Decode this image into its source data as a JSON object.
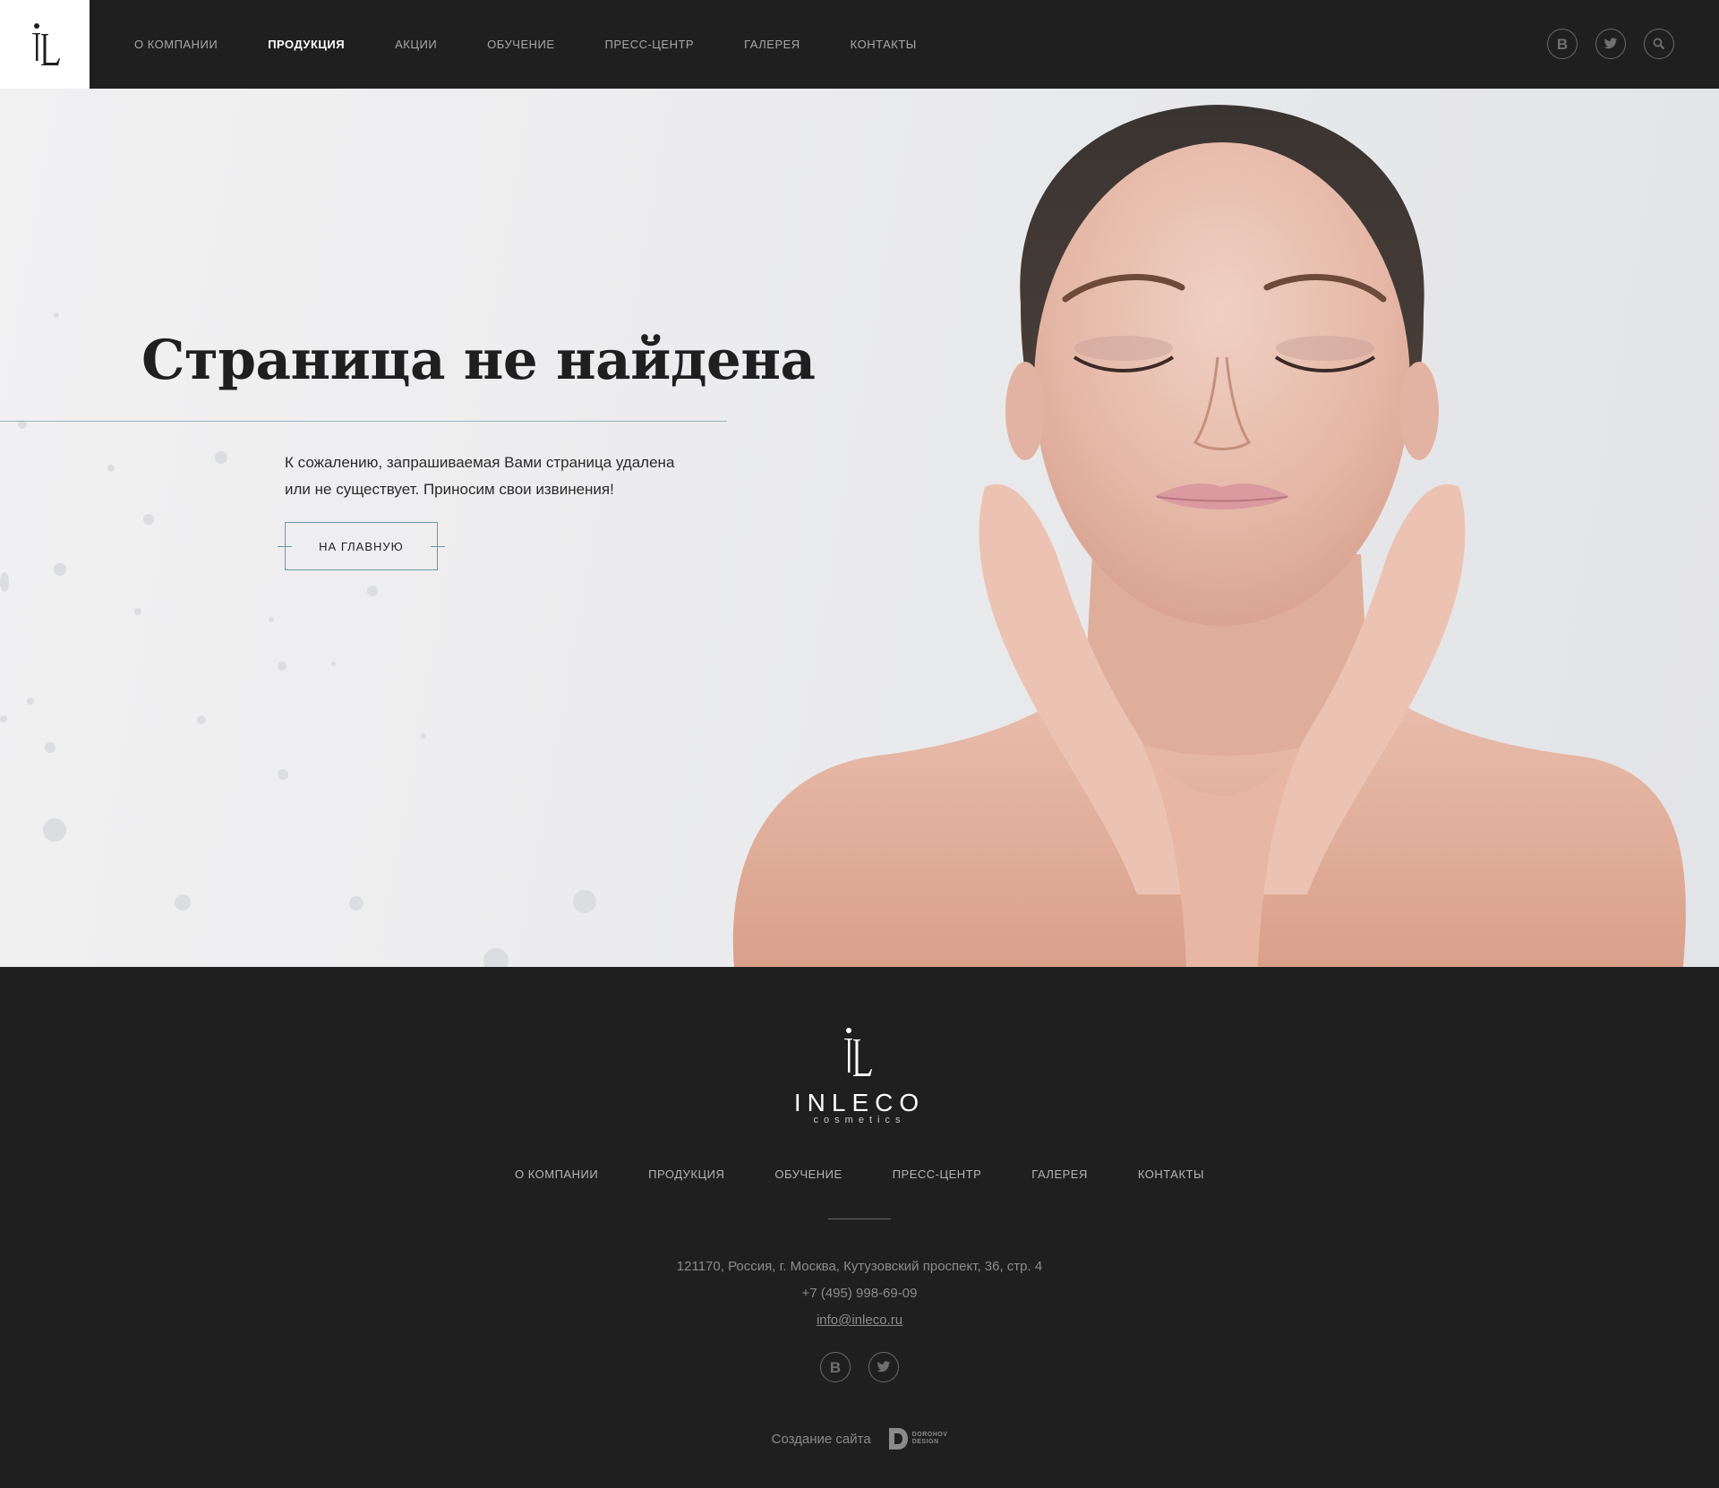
{
  "header": {
    "logo_icon": "inleco-monogram-icon",
    "nav": [
      {
        "label": "О КОМПАНИИ",
        "active": false
      },
      {
        "label": "ПРОДУКЦИЯ",
        "active": true
      },
      {
        "label": "АКЦИИ",
        "active": false
      },
      {
        "label": "ОБУЧЕНИЕ",
        "active": false
      },
      {
        "label": "ПРЕСС-ЦЕНТР",
        "active": false
      },
      {
        "label": "ГАЛЕРЕЯ",
        "active": false
      },
      {
        "label": "КОНТАКТЫ",
        "active": false
      }
    ],
    "vk_letter": "B",
    "icons": [
      "vk-icon",
      "twitter-icon",
      "search-icon"
    ]
  },
  "hero": {
    "title": "Страница не найдена",
    "text_line1": "К сожалению, запрашиваемая Вами страница удалена",
    "text_line2": "или не существует. Приносим свои извинения!",
    "button_label": "НА ГЛАВНУЮ"
  },
  "footer": {
    "brand": "INLECO",
    "brand_sub": "cosmetics",
    "nav": [
      "О КОМПАНИИ",
      "ПРОДУКЦИЯ",
      "ОБУЧЕНИЕ",
      "ПРЕСС-ЦЕНТР",
      "ГАЛЕРЕЯ",
      "КОНТАКТЫ"
    ],
    "address": "121170, Россия, г. Москва, Кутузовский проспект, 36, стр. 4",
    "phone": "+7 (495) 998-69-09",
    "email": "info@inleco.ru",
    "vk_letter": "B",
    "credit_text": "Создание сайта",
    "credit_logo_line1": "DOROHOV",
    "credit_logo_line2": "DESIGN"
  },
  "colors": {
    "dark": "#1f1f1f",
    "accent": "#6c97a6",
    "nav_text": "#a8a8a8"
  }
}
